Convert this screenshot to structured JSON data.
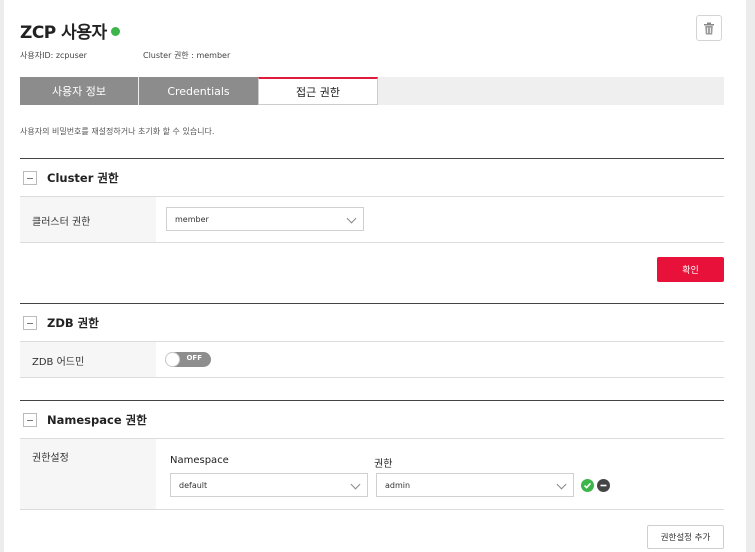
{
  "header": {
    "title": "ZCP 사용자",
    "status_color": "#3cb54a",
    "user_id_text": "사용자ID: zcpuser",
    "cluster_role_text": "Cluster 권한 : member",
    "delete_icon": "trash-icon"
  },
  "tabs": [
    {
      "label": "사용자 정보",
      "active": false
    },
    {
      "label": "Credentials",
      "active": false
    },
    {
      "label": "접근 권한",
      "active": true
    }
  ],
  "description": "사용자의 비밀번호를 재설정하거나 초기화 할 수 있습니다.",
  "cluster_section": {
    "title": "Cluster 권한",
    "row_label": "클러스터 권한",
    "select_value": "member",
    "confirm_label": "확인"
  },
  "zdb_section": {
    "title": "ZDB 권한",
    "row_label": "ZDB 어드민",
    "toggle_text": "OFF",
    "toggle_on": false
  },
  "namespace_section": {
    "title": "Namespace 권한",
    "row_label": "권한설정",
    "col_namespace": "Namespace",
    "col_role": "권한",
    "namespace_value": "default",
    "role_value": "admin",
    "add_label": "권한설정 추가"
  },
  "colors": {
    "accent_red": "#e8113a",
    "tab_dark": "#8c8c8c",
    "confirm_green": "#3cb54a",
    "remove_dark": "#444444"
  }
}
